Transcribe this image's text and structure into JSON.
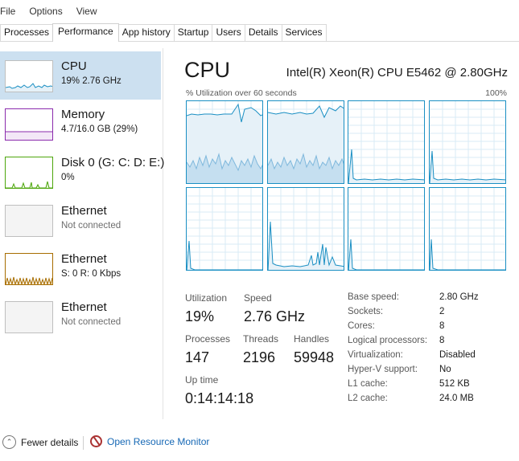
{
  "menu": [
    "File",
    "Options",
    "View"
  ],
  "tabs": [
    "Processes",
    "Performance",
    "App history",
    "Startup",
    "Users",
    "Details",
    "Services"
  ],
  "active_tab": "Performance",
  "resources": [
    {
      "title": "CPU",
      "sub": "19% 2.76 GHz",
      "color": "#1a8fc3",
      "selected": true
    },
    {
      "title": "Memory",
      "sub": "4.7/16.0 GB (29%)",
      "color": "#8b2bad",
      "selected": false
    },
    {
      "title": "Disk 0 (G: C: D: E:)",
      "sub": "0%",
      "color": "#4da60c",
      "selected": false
    },
    {
      "title": "Ethernet",
      "sub": "Not connected",
      "color": "#b0b0b0",
      "selected": false
    },
    {
      "title": "Ethernet",
      "sub": "S: 0 R: 0 Kbps",
      "color": "#a76d00",
      "selected": false
    },
    {
      "title": "Ethernet",
      "sub": "Not connected",
      "color": "#b0b0b0",
      "selected": false
    }
  ],
  "main": {
    "title": "CPU",
    "model": "Intel(R) Xeon(R) CPU E5462 @ 2.80GHz",
    "util_label": "% Utilization over 60 seconds",
    "util_max": "100%",
    "graph_color": "#1a8fc3",
    "stats": {
      "utilization_label": "Utilization",
      "utilization": "19%",
      "speed_label": "Speed",
      "speed": "2.76 GHz",
      "processes_label": "Processes",
      "processes": "147",
      "threads_label": "Threads",
      "threads": "2196",
      "handles_label": "Handles",
      "handles": "59948",
      "uptime_label": "Up time",
      "uptime": "0:14:14:18"
    },
    "details": [
      {
        "key": "Base speed:",
        "value": "2.80 GHz"
      },
      {
        "key": "Sockets:",
        "value": "2"
      },
      {
        "key": "Cores:",
        "value": "8"
      },
      {
        "key": "Logical processors:",
        "value": "8"
      },
      {
        "key": "Virtualization:",
        "value": "Disabled"
      },
      {
        "key": "Hyper-V support:",
        "value": "No"
      },
      {
        "key": "L1 cache:",
        "value": "512 KB"
      },
      {
        "key": "L2 cache:",
        "value": "24.0 MB"
      }
    ]
  },
  "footer": {
    "fewer_details": "Fewer details",
    "open_resource_monitor": "Open Resource Monitor",
    "fewer_icon": "chevron-up-icon",
    "monitor_icon": "resource-monitor-icon"
  }
}
